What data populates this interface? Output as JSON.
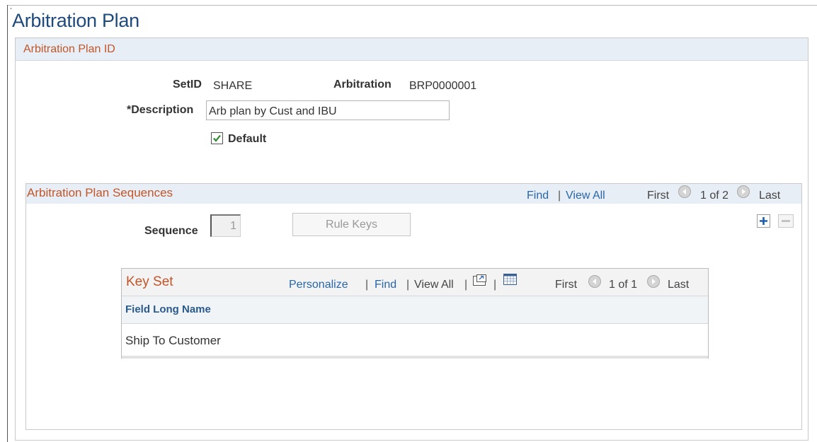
{
  "page": {
    "title": "Arbitration Plan",
    "corner_mark": "¸"
  },
  "header_group": {
    "label": "Arbitration Plan ID",
    "setid_label": "SetID",
    "setid_value": "SHARE",
    "arbitration_label": "Arbitration",
    "arbitration_value": "BRP0000001",
    "description_label": "*Description",
    "description_value": "Arb plan by Cust and IBU",
    "default_label": "Default",
    "default_checked": true
  },
  "sequences": {
    "label": "Arbitration Plan Sequences",
    "find": "Find",
    "separator": "|",
    "view_all": "View All",
    "first": "First",
    "counter": "1 of 2",
    "last": "Last",
    "sequence_label": "Sequence",
    "sequence_value": "1",
    "rule_keys_button": "Rule Keys"
  },
  "key_set": {
    "title": "Key Set",
    "personalize": "Personalize",
    "find": "Find",
    "view_all": "View All",
    "separator": "|",
    "first": "First",
    "counter": "1 of 1",
    "last": "Last",
    "columns": [
      "Field Long Name"
    ],
    "rows": [
      [
        "Ship To Customer"
      ]
    ]
  },
  "colors": {
    "title": "#1f4a7c",
    "group_label": "#c0562a",
    "link": "#2966a8",
    "header_bg": "#e8eef5"
  },
  "icons": {
    "prev": "arrow-left-icon",
    "next": "arrow-right-icon",
    "checkbox": "checkmark-icon",
    "add_row": "plus-icon",
    "delete_row": "minus-icon",
    "zoom": "zoom-icon",
    "download": "grid-icon"
  }
}
